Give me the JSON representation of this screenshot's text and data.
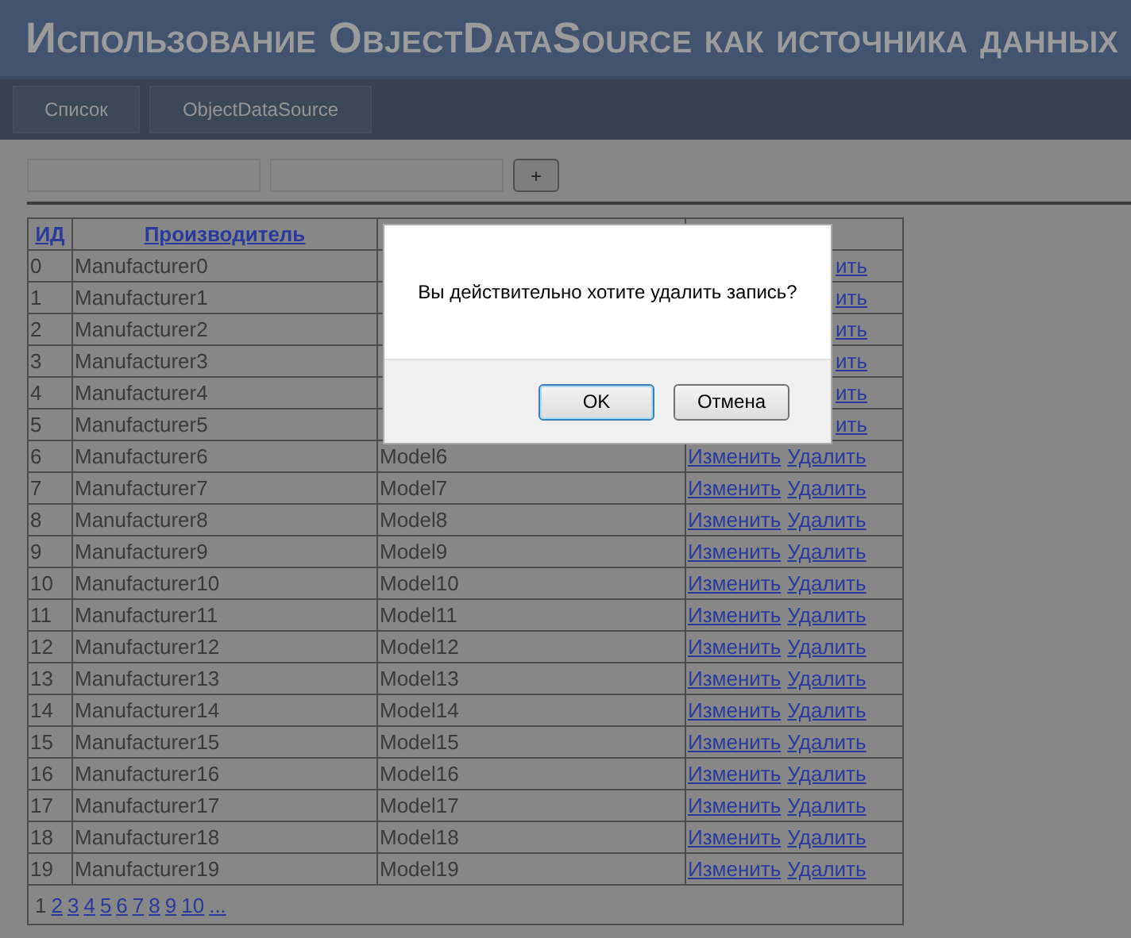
{
  "title": "Использование ObjectDataSource как источника данных",
  "tabs": [
    {
      "label": "Список"
    },
    {
      "label": "ObjectDataSource"
    }
  ],
  "form": {
    "add_button": "+"
  },
  "table": {
    "columns": [
      "ИД",
      "Производитель"
    ],
    "rows": [
      {
        "id": "0",
        "manufacturer": "Manufacturer0",
        "delete": "ить"
      },
      {
        "id": "1",
        "manufacturer": "Manufacturer1",
        "delete": "ить"
      },
      {
        "id": "2",
        "manufacturer": "Manufacturer2",
        "delete": "ить"
      },
      {
        "id": "3",
        "manufacturer": "Manufacturer3",
        "delete": "ить"
      },
      {
        "id": "4",
        "manufacturer": "Manufacturer4",
        "delete": "ить"
      },
      {
        "id": "5",
        "manufacturer": "Manufacturer5",
        "delete": "ить"
      },
      {
        "id": "6",
        "manufacturer": "Manufacturer6",
        "model": "Model6",
        "edit": "Изменить",
        "delete": "Удалить"
      },
      {
        "id": "7",
        "manufacturer": "Manufacturer7",
        "model": "Model7",
        "edit": "Изменить",
        "delete": "Удалить"
      },
      {
        "id": "8",
        "manufacturer": "Manufacturer8",
        "model": "Model8",
        "edit": "Изменить",
        "delete": "Удалить"
      },
      {
        "id": "9",
        "manufacturer": "Manufacturer9",
        "model": "Model9",
        "edit": "Изменить",
        "delete": "Удалить"
      },
      {
        "id": "10",
        "manufacturer": "Manufacturer10",
        "model": "Model10",
        "edit": "Изменить",
        "delete": "Удалить"
      },
      {
        "id": "11",
        "manufacturer": "Manufacturer11",
        "model": "Model11",
        "edit": "Изменить",
        "delete": "Удалить"
      },
      {
        "id": "12",
        "manufacturer": "Manufacturer12",
        "model": "Model12",
        "edit": "Изменить",
        "delete": "Удалить"
      },
      {
        "id": "13",
        "manufacturer": "Manufacturer13",
        "model": "Model13",
        "edit": "Изменить",
        "delete": "Удалить"
      },
      {
        "id": "14",
        "manufacturer": "Manufacturer14",
        "model": "Model14",
        "edit": "Изменить",
        "delete": "Удалить"
      },
      {
        "id": "15",
        "manufacturer": "Manufacturer15",
        "model": "Model15",
        "edit": "Изменить",
        "delete": "Удалить"
      },
      {
        "id": "16",
        "manufacturer": "Manufacturer16",
        "model": "Model16",
        "edit": "Изменить",
        "delete": "Удалить"
      },
      {
        "id": "17",
        "manufacturer": "Manufacturer17",
        "model": "Model17",
        "edit": "Изменить",
        "delete": "Удалить"
      },
      {
        "id": "18",
        "manufacturer": "Manufacturer18",
        "model": "Model18",
        "edit": "Изменить",
        "delete": "Удалить"
      },
      {
        "id": "19",
        "manufacturer": "Manufacturer19",
        "model": "Model19",
        "edit": "Изменить",
        "delete": "Удалить"
      }
    ],
    "pager": [
      {
        "label": "1",
        "selected": true
      },
      {
        "label": "2",
        "selected": false
      },
      {
        "label": "3",
        "selected": false
      },
      {
        "label": "4",
        "selected": false
      },
      {
        "label": "5",
        "selected": false
      },
      {
        "label": "6",
        "selected": false
      },
      {
        "label": "7",
        "selected": false
      },
      {
        "label": "8",
        "selected": false
      },
      {
        "label": "9",
        "selected": false
      },
      {
        "label": "10",
        "selected": false
      },
      {
        "label": "...",
        "selected": false
      }
    ]
  },
  "dialog": {
    "message": "Вы действительно хотите удалить запись?",
    "buttons": [
      {
        "label": "OK",
        "default": true
      },
      {
        "label": "Отмена",
        "default": false
      }
    ]
  }
}
